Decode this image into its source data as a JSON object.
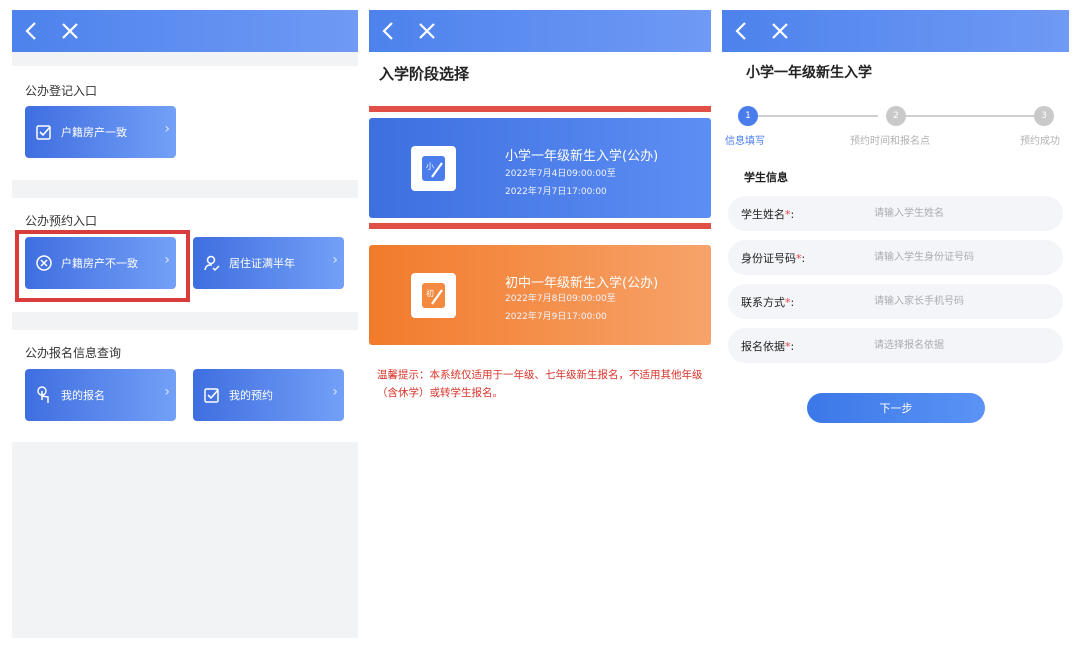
{
  "panel1": {
    "section1": {
      "title": "公办登记入口",
      "tiles": [
        {
          "label": "户籍房产一致",
          "icon": "checkbox-icon"
        }
      ]
    },
    "section2": {
      "title": "公办预约入口",
      "tiles": [
        {
          "label": "户籍房产不一致",
          "icon": "circle-x-icon"
        },
        {
          "label": "居住证满半年",
          "icon": "person-check-icon"
        }
      ]
    },
    "section3": {
      "title": "公办报名信息查询",
      "tiles": [
        {
          "label": "我的报名",
          "icon": "touch-icon"
        },
        {
          "label": "我的预约",
          "icon": "checkbox-icon"
        }
      ]
    }
  },
  "panel2": {
    "title": "入学阶段选择",
    "cards": [
      {
        "badge": "小",
        "title": "小学一年级新生入学(公办)",
        "line1": "2022年7月4日09:00:00至",
        "line2": "2022年7月7日17:00:00",
        "color": "#4a7cec"
      },
      {
        "badge": "初",
        "title": "初中一年级新生入学(公办)",
        "line1": "2022年7月8日09:00:00至",
        "line2": "2022年7月9日17:00:00",
        "color": "#f38a3f"
      }
    ],
    "notice": "温馨提示：本系统仅适用于一年级、七年级新生报名，不适用其他年级（含休学）或转学生报名。"
  },
  "panel3": {
    "title": "小学一年级新生入学",
    "steps": [
      {
        "num": "1",
        "label": "信息填写"
      },
      {
        "num": "2",
        "label": "预约时间和报名点"
      },
      {
        "num": "3",
        "label": "预约成功"
      }
    ],
    "section_title": "学生信息",
    "fields": [
      {
        "label": "学生姓名",
        "req": "*",
        "colon": ":",
        "placeholder": "请输入学生姓名"
      },
      {
        "label": "身份证号码",
        "req": "*",
        "colon": ":",
        "placeholder": "请输入学生身份证号码"
      },
      {
        "label": "联系方式",
        "req": "*",
        "colon": ":",
        "placeholder": "请输入家长手机号码"
      },
      {
        "label": "报名依据",
        "req": "*",
        "colon": ":",
        "placeholder": "请选择报名依据"
      }
    ],
    "next_label": "下一步"
  },
  "colors": {
    "primary": "#4a7cec",
    "orange": "#f38a3f",
    "highlight": "#d93c3c",
    "notice": "#d9342b"
  }
}
